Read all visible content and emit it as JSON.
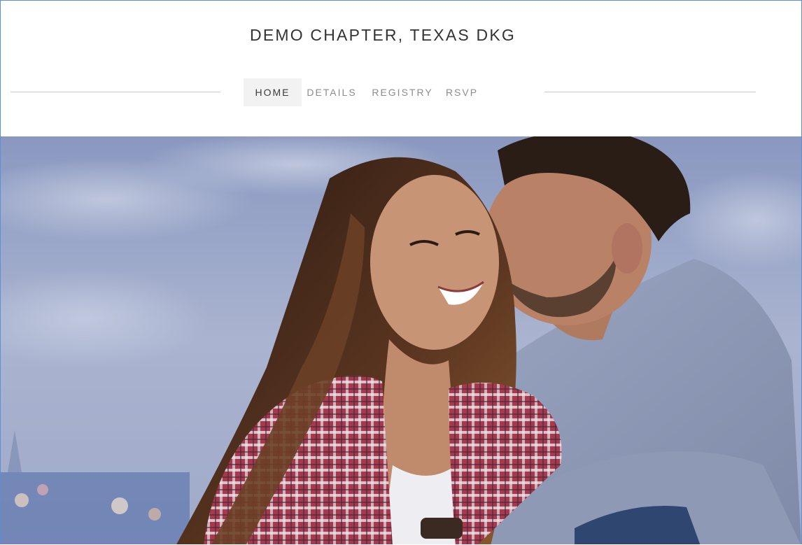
{
  "site": {
    "title": "DEMO CHAPTER, TEXAS DKG"
  },
  "nav": {
    "items": [
      {
        "label": "HOME",
        "active": true
      },
      {
        "label": "DETAILS",
        "active": false
      },
      {
        "label": "REGISTRY",
        "active": false
      },
      {
        "label": "RSVP",
        "active": false
      }
    ]
  },
  "hero": {
    "image": "couple-photo"
  },
  "colors": {
    "frame_border": "#5b8fd6",
    "nav_active_bg": "#f2f2f2",
    "nav_active_text": "#3a3a3a",
    "nav_text": "#8c8c8c",
    "title_text": "#333333"
  }
}
